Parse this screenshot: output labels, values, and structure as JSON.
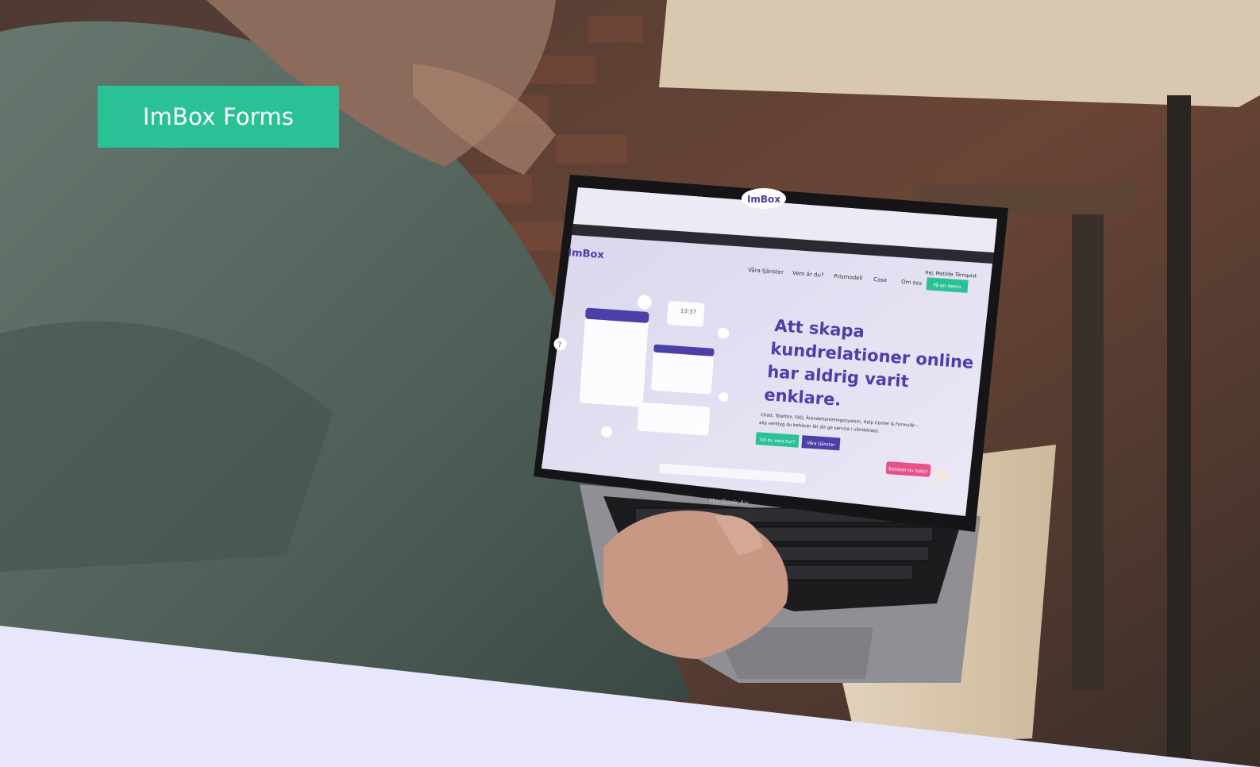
{
  "badge": {
    "label": "ImBox Forms"
  },
  "laptop": {
    "notch_logo": "ImBox",
    "model_label": "MacBook Air"
  },
  "website": {
    "logo": "ImBox",
    "greeting": "Hej, Matilda Törnquist",
    "nav": [
      "Våra tjänster",
      "Vem är du?",
      "Prismodell",
      "Case",
      "Om oss"
    ],
    "cta_demo": "Få en demo",
    "headline_lines": [
      "Att skapa",
      "kundrelationer online",
      "har aldrig varit",
      "enklare."
    ],
    "subtext_lines": [
      "Chatt, Telefoni, FAQ, Ärendehanteringssystem, Help Center & Formulär –",
      "alla verktyg du behöver för att ge service i världsklass."
    ],
    "primary_button": "Vill du veta hur?",
    "secondary_button": "Våra tjänster",
    "help_button": "Behöver du hjälp?",
    "time_widget": "13:37"
  },
  "colors": {
    "badge": "#2bc196",
    "bottom_band": "#e8e6fb",
    "imbox_purple": "#4b3fa8",
    "imbox_green": "#2bc196",
    "help_pink": "#e8508a"
  }
}
